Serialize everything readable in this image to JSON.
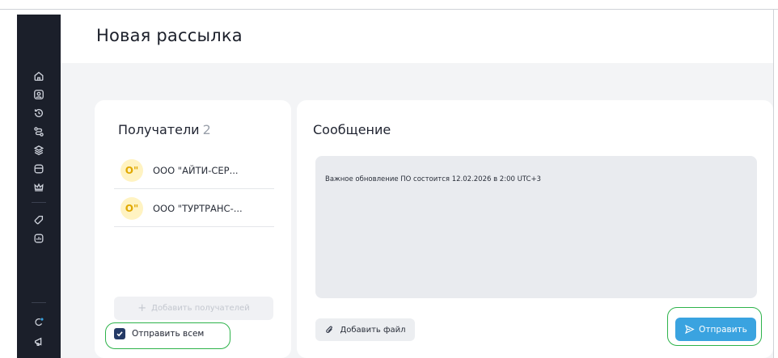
{
  "page": {
    "title": "Новая рассылка"
  },
  "sidebar": {
    "icons": [
      "home-icon",
      "profile-icon",
      "history-icon",
      "routes-icon",
      "layers-icon",
      "database-icon",
      "crown-icon",
      "tag-icon",
      "report-icon",
      "bell-icon",
      "megaphone-icon"
    ],
    "notification_color": "#3aa3e0"
  },
  "recipients": {
    "title": "Получатели",
    "count": "2",
    "items": [
      {
        "avatar": "О\"",
        "name": "ООО \"АЙТИ-СЕР..."
      },
      {
        "avatar": "О\"",
        "name": "ООО \"ТУРТРАНС-..."
      }
    ],
    "add_button": "Добавить получателей",
    "send_all_label": "Отправить всем",
    "send_all_checked": true
  },
  "message": {
    "title": "Сообщение",
    "text": "Важное обновление ПО состоится 12.02.2026 в 2:00 UTC+3",
    "attach_button": "Добавить файл",
    "send_button": "Отправить"
  },
  "colors": {
    "sidebar": "#1b1f2a",
    "accent": "#3aa3e0",
    "highlight": "#2db34a",
    "checkbox": "#243a66",
    "avatar_bg": "#fff3c2",
    "avatar_fg": "#e0a800"
  }
}
